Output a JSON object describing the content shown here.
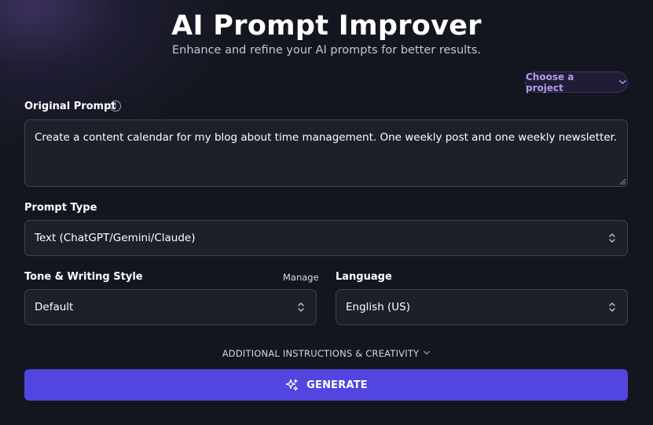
{
  "header": {
    "title": "AI Prompt Improver",
    "subtitle": "Enhance and refine your AI prompts for better results."
  },
  "project_select": {
    "label": "Choose a project",
    "icon": "chevron-down-icon"
  },
  "original_prompt": {
    "label": "Original Prompt",
    "info_icon": "info-icon",
    "value": "Create a content calendar for my blog about time management. One weekly post and one weekly newsletter."
  },
  "prompt_type": {
    "label": "Prompt Type",
    "value": "Text (ChatGPT/Gemini/Claude)"
  },
  "tone": {
    "label": "Tone & Writing Style",
    "manage_label": "Manage",
    "value": "Default"
  },
  "language": {
    "label": "Language",
    "value": "English (US)"
  },
  "additional": {
    "label": "ADDITIONAL INSTRUCTIONS & CREATIVITY"
  },
  "generate": {
    "label": "GENERATE",
    "icon": "sparkles-icon"
  },
  "colors": {
    "background": "#14161f",
    "accent": "#5245e0",
    "field_bg": "#1c2029",
    "field_border": "#3d4350",
    "project_text": "#b49ae8"
  }
}
